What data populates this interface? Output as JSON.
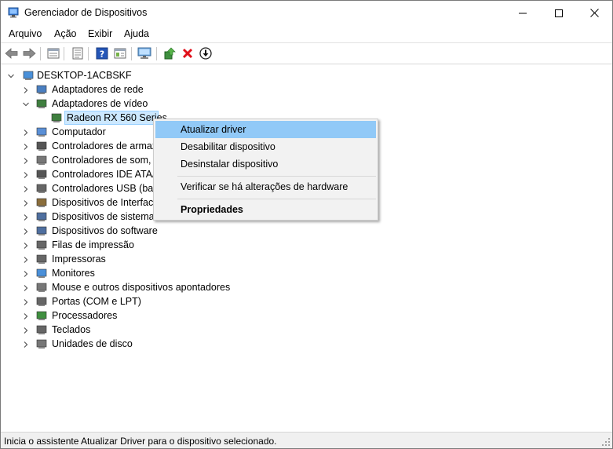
{
  "window": {
    "title": "Gerenciador de Dispositivos",
    "controls": {
      "minimize": "minimize-icon",
      "maximize": "maximize-icon",
      "close": "close-icon"
    }
  },
  "menubar": {
    "items": [
      "Arquivo",
      "Ação",
      "Exibir",
      "Ajuda"
    ]
  },
  "toolbar": {
    "icons": [
      "back-arrow-icon",
      "forward-arrow-icon",
      "properties-view-icon",
      "list-view-icon",
      "help-icon",
      "details-view-icon",
      "monitor-scan-icon",
      "update-driver-icon",
      "uninstall-icon",
      "download-icon"
    ]
  },
  "tree": {
    "root": "DESKTOP-1ACBSKF",
    "items": [
      {
        "label": "Adaptadores de rede",
        "expanded": false
      },
      {
        "label": "Adaptadores de vídeo",
        "expanded": true
      },
      {
        "label": "Radeon RX 560 Series",
        "child": true,
        "selected": true
      },
      {
        "label": "Computador",
        "expanded": false
      },
      {
        "label": "Controladores de armaz",
        "expanded": false
      },
      {
        "label": "Controladores de som, v",
        "expanded": false
      },
      {
        "label": "Controladores IDE ATA/A",
        "expanded": false
      },
      {
        "label": "Controladores USB (barr",
        "expanded": false
      },
      {
        "label": "Dispositivos de Interface",
        "expanded": false
      },
      {
        "label": "Dispositivos de sistema",
        "expanded": false
      },
      {
        "label": "Dispositivos do software",
        "expanded": false
      },
      {
        "label": "Filas de impressão",
        "expanded": false
      },
      {
        "label": "Impressoras",
        "expanded": false
      },
      {
        "label": "Monitores",
        "expanded": false
      },
      {
        "label": "Mouse e outros dispositivos apontadores",
        "expanded": false
      },
      {
        "label": "Portas (COM e LPT)",
        "expanded": false
      },
      {
        "label": "Processadores",
        "expanded": false
      },
      {
        "label": "Teclados",
        "expanded": false
      },
      {
        "label": "Unidades de disco",
        "expanded": false
      }
    ]
  },
  "context_menu": {
    "items": [
      {
        "label": "Atualizar driver",
        "hover": true
      },
      {
        "label": "Desabilitar dispositivo"
      },
      {
        "label": "Desinstalar dispositivo"
      },
      {
        "label": "Verificar se há alterações de hardware"
      },
      {
        "label": "Propriedades",
        "bold": true
      }
    ]
  },
  "statusbar": {
    "text": "Inicia o assistente Atualizar Driver para o dispositivo selecionado."
  },
  "colors": {
    "selection": "#cce8ff",
    "menu_hover": "#91c9f7",
    "menu_bg": "#f2f2f2",
    "statusbar_bg": "#f0f0f0"
  }
}
